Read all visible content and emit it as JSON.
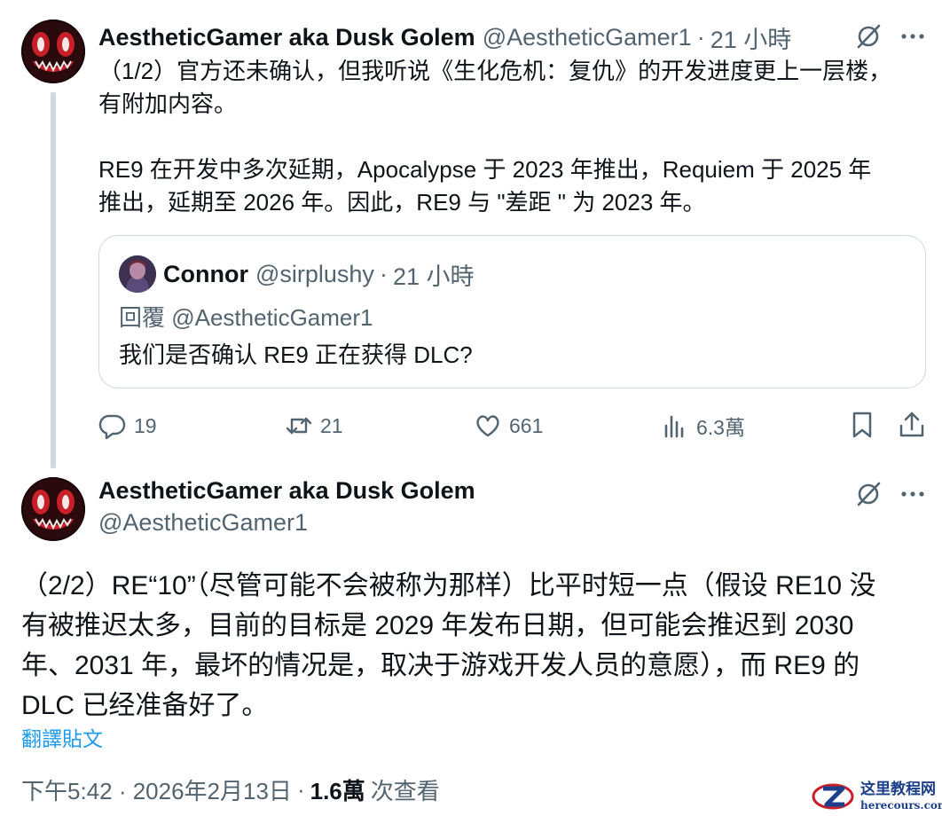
{
  "tweet1": {
    "author": {
      "name": "AestheticGamer aka Dusk Golem",
      "handle": "@AestheticGamer1",
      "avatar_icon": "grinning-monster-avatar"
    },
    "separator": "·",
    "time": "21 小時",
    "body_lines": [
      "（1/2）官方还未确认，但我听说《生化危机：复仇》的开发进度更上一层楼，",
      "有附加内容。",
      "RE9 在开发中多次延期，Apocalypse 于 2023 年推出，Requiem 于 2025 年",
      "推出，延期至 2026 年。因此，RE9 与 \"差距 \" 为 2023 年。"
    ],
    "quote": {
      "author_name": "Connor",
      "author_handle": "@sirplushy",
      "separator": "·",
      "time": "21 小時",
      "reply_to": "回覆 @AestheticGamer1",
      "text": "我们是否确认 RE9 正在获得 DLC?"
    },
    "actions": {
      "replies": "19",
      "reposts": "21",
      "likes": "661",
      "views": "6.3萬"
    }
  },
  "tweet2": {
    "author": {
      "name": "AestheticGamer aka Dusk Golem",
      "handle": "@AestheticGamer1"
    },
    "body_lines": [
      "（2/2）RE“10”（尽管可能不会被称为那样）比平时短一点（假设 RE10 没",
      "有被推迟太多，目前的目标是 2029 年发布日期，但可能会推迟到 2030",
      "年、2031 年，最坏的情况是，取决于游戏开发人员的意愿），而 RE9 的",
      "DLC 已经准备好了。"
    ],
    "translate_link": "翻譯貼文",
    "timestamp": "下午5:42 · 2026年2月13日",
    "separator": "·",
    "views_count": "1.6萬",
    "views_label": "次查看"
  },
  "watermark": {
    "main": "这里教程网",
    "sub": "herecours.com"
  },
  "colors": {
    "text": "#0f1419",
    "muted": "#536471",
    "link": "#1d9bf0",
    "border": "#cfd9de",
    "watermark": "#1b3f8b"
  },
  "icons": [
    "grok-icon",
    "more-icon",
    "reply-icon",
    "repost-icon",
    "like-icon",
    "views-icon",
    "bookmark-icon",
    "share-icon"
  ]
}
